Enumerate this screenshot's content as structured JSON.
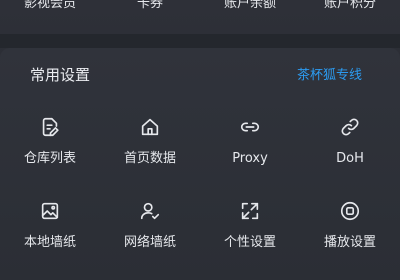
{
  "top_row": {
    "items": [
      {
        "label": "影视会员"
      },
      {
        "label": "卡券"
      },
      {
        "label": "账户余额"
      },
      {
        "label": "账户积分"
      }
    ]
  },
  "section": {
    "title": "常用设置",
    "link": "茶杯狐专线"
  },
  "tiles": [
    {
      "label": "仓库列表",
      "icon": "edit-document-icon"
    },
    {
      "label": "首页数据",
      "icon": "home-icon"
    },
    {
      "label": "Proxy",
      "icon": "link-icon"
    },
    {
      "label": "DoH",
      "icon": "chain-link-icon"
    },
    {
      "label": "本地墙纸",
      "icon": "image-icon"
    },
    {
      "label": "网络墙纸",
      "icon": "user-check-icon"
    },
    {
      "label": "个性设置",
      "icon": "expand-arrows-icon"
    },
    {
      "label": "播放设置",
      "icon": "stop-circle-icon"
    }
  ],
  "colors": {
    "accent": "#2c9bf0",
    "background": "#2b2e35",
    "text": "#e6e8ec"
  }
}
